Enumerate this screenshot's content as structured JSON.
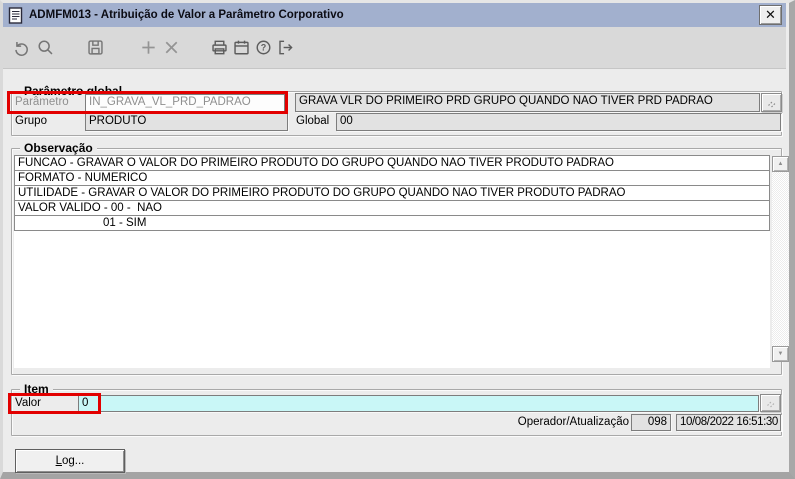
{
  "window": {
    "title": "ADMFM013 - Atribuição de Valor a Parâmetro Corporativo"
  },
  "icons": {
    "close": "✕",
    "scroll_up": "▲",
    "scroll_down": "▼",
    "toolbar": [
      "undo-icon",
      "search-icon",
      "save-icon",
      "add-icon",
      "delete-icon",
      "print-icon",
      "calendar-icon",
      "help-icon",
      "exit-icon"
    ]
  },
  "parametro_global": {
    "legend": "Parâmetro global",
    "parametro_label": "Parâmetro",
    "parametro_value": "IN_GRAVA_VL_PRD_PADRAO",
    "descricao_value": "GRAVA VLR DO PRIMEIRO PRD GRUPO QUANDO NAO TIVER PRD PADRAO",
    "grupo_label": "Grupo",
    "grupo_value": "PRODUTO",
    "global_label": "Global",
    "global_value": "00"
  },
  "observacao": {
    "legend": "Observação",
    "rows": [
      "FUNCAO - GRAVAR O VALOR DO PRIMEIRO PRODUTO DO GRUPO QUANDO NAO TIVER PRODUTO PADRAO",
      "FORMATO - NUMERICO",
      "UTILIDADE - GRAVAR O VALOR DO PRIMEIRO PRODUTO DO GRUPO QUANDO NAO TIVER PRODUTO PADRAO",
      "VALOR VALIDO - 00 -  NAO",
      "01 - SIM"
    ]
  },
  "item": {
    "legend": "Item",
    "valor_label": "Valor",
    "valor_value": "0",
    "operador_label": "Operador/Atualização",
    "operador_value": "098",
    "atualizacao_value": "10/08/2022 16:51:30"
  },
  "footer": {
    "log_mnemonic": "L",
    "log_rest": "og..."
  },
  "colors": {
    "titlebar": "#a2b0ce",
    "window_face": "#ececec",
    "field_gray": "#e2e2e2",
    "field_cyan": "#c9f7f7",
    "highlight_red": "#e20000",
    "disabled_text": "#8f8f8f"
  }
}
